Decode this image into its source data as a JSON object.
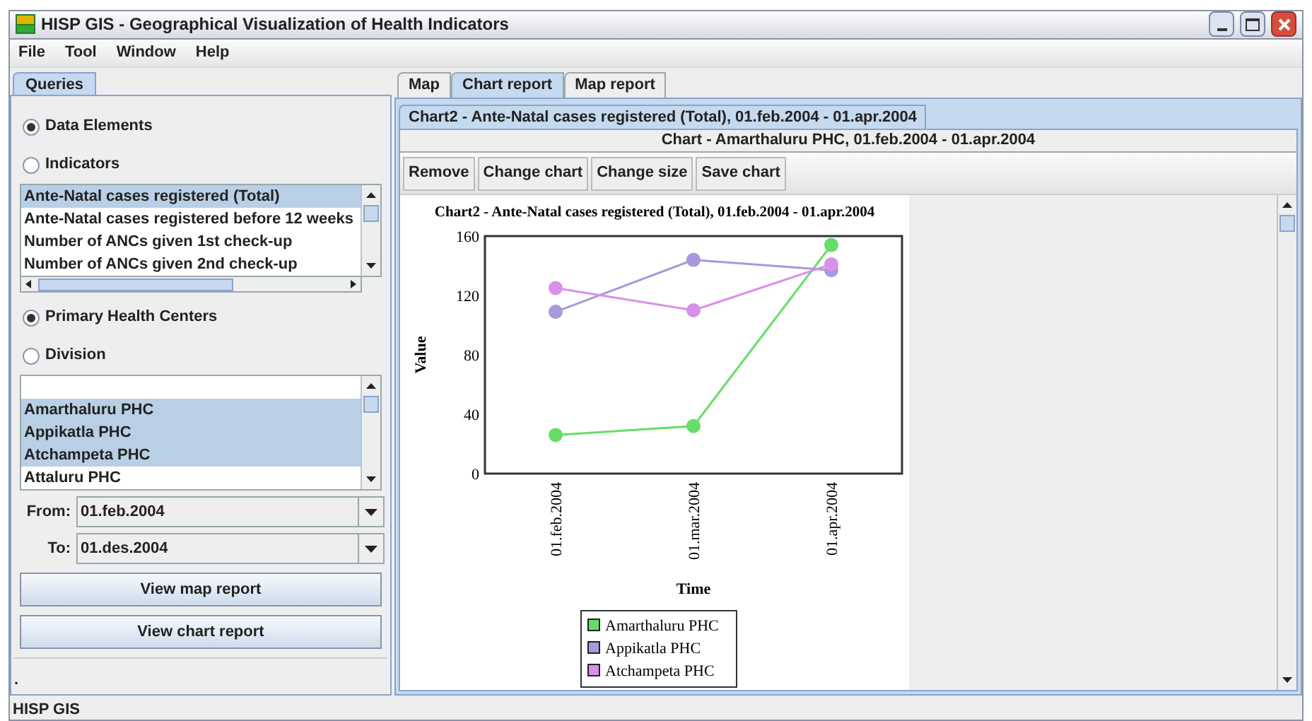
{
  "window": {
    "title": "HISP GIS - Geographical Visualization of Health Indicators"
  },
  "menu": [
    "File",
    "Tool",
    "Window",
    "Help"
  ],
  "left_tabs": [
    {
      "label": "Queries",
      "selected": true
    }
  ],
  "data_options": [
    {
      "label": "Data Elements",
      "selected": true
    },
    {
      "label": "Indicators",
      "selected": false
    }
  ],
  "element_list": [
    {
      "label": "Ante-Natal cases registered (Total)",
      "selected": true
    },
    {
      "label": "Ante-Natal cases registered before 12 weeks",
      "selected": false
    },
    {
      "label": "Number of ANCs given 1st check-up",
      "selected": false
    },
    {
      "label": "Number of ANCs given 2nd check-up",
      "selected": false
    }
  ],
  "org_options": [
    {
      "label": "Primary Health Centers",
      "selected": true
    },
    {
      "label": "Division",
      "selected": false
    }
  ],
  "org_list": [
    {
      "label": "Amarthaluru PHC",
      "selected": true
    },
    {
      "label": "Appikatla PHC",
      "selected": true
    },
    {
      "label": "Atchampeta PHC",
      "selected": true
    },
    {
      "label": "Attaluru PHC",
      "selected": false
    }
  ],
  "from": {
    "label": "From:",
    "value": "01.feb.2004"
  },
  "to": {
    "label": "To:",
    "value": "01.des.2004"
  },
  "actions": [
    "View map report",
    "View chart report"
  ],
  "message": ".",
  "right_tabs": [
    {
      "label": "Map",
      "selected": false
    },
    {
      "label": "Chart report",
      "selected": true
    },
    {
      "label": "Map report",
      "selected": false
    }
  ],
  "chart_tabs": [
    {
      "label": "Chart2 - Ante-Natal cases registered (Total), 01.feb.2004 - 01.apr.2004",
      "selected": true
    }
  ],
  "chart_subtitle": "Chart - Amarthaluru PHC, 01.feb.2004 - 01.apr.2004",
  "toolbar": [
    "Remove",
    "Change chart",
    "Change size",
    "Save chart"
  ],
  "chart_data": {
    "type": "line",
    "title": "Chart2 - Ante-Natal cases registered (Total), 01.feb.2004 - 01.apr.2004",
    "xlabel": "Time",
    "ylabel": "Value",
    "categories": [
      "01.feb.2004",
      "01.mar.2004",
      "01.apr.2004"
    ],
    "ylim": [
      0,
      160
    ],
    "yticks": [
      0,
      40,
      80,
      120,
      160
    ],
    "legend": true,
    "series": [
      {
        "name": "Amarthaluru PHC",
        "color": "#66dd66",
        "marker": "circle",
        "values": [
          26,
          32,
          154
        ]
      },
      {
        "name": "Appikatla PHC",
        "color": "#a898dc",
        "marker": "circle",
        "values": [
          109,
          144,
          137
        ]
      },
      {
        "name": "Atchampeta PHC",
        "color": "#d890e8",
        "marker": "circle",
        "values": [
          125,
          110,
          141
        ]
      }
    ]
  },
  "status_bar": "HISP GIS"
}
